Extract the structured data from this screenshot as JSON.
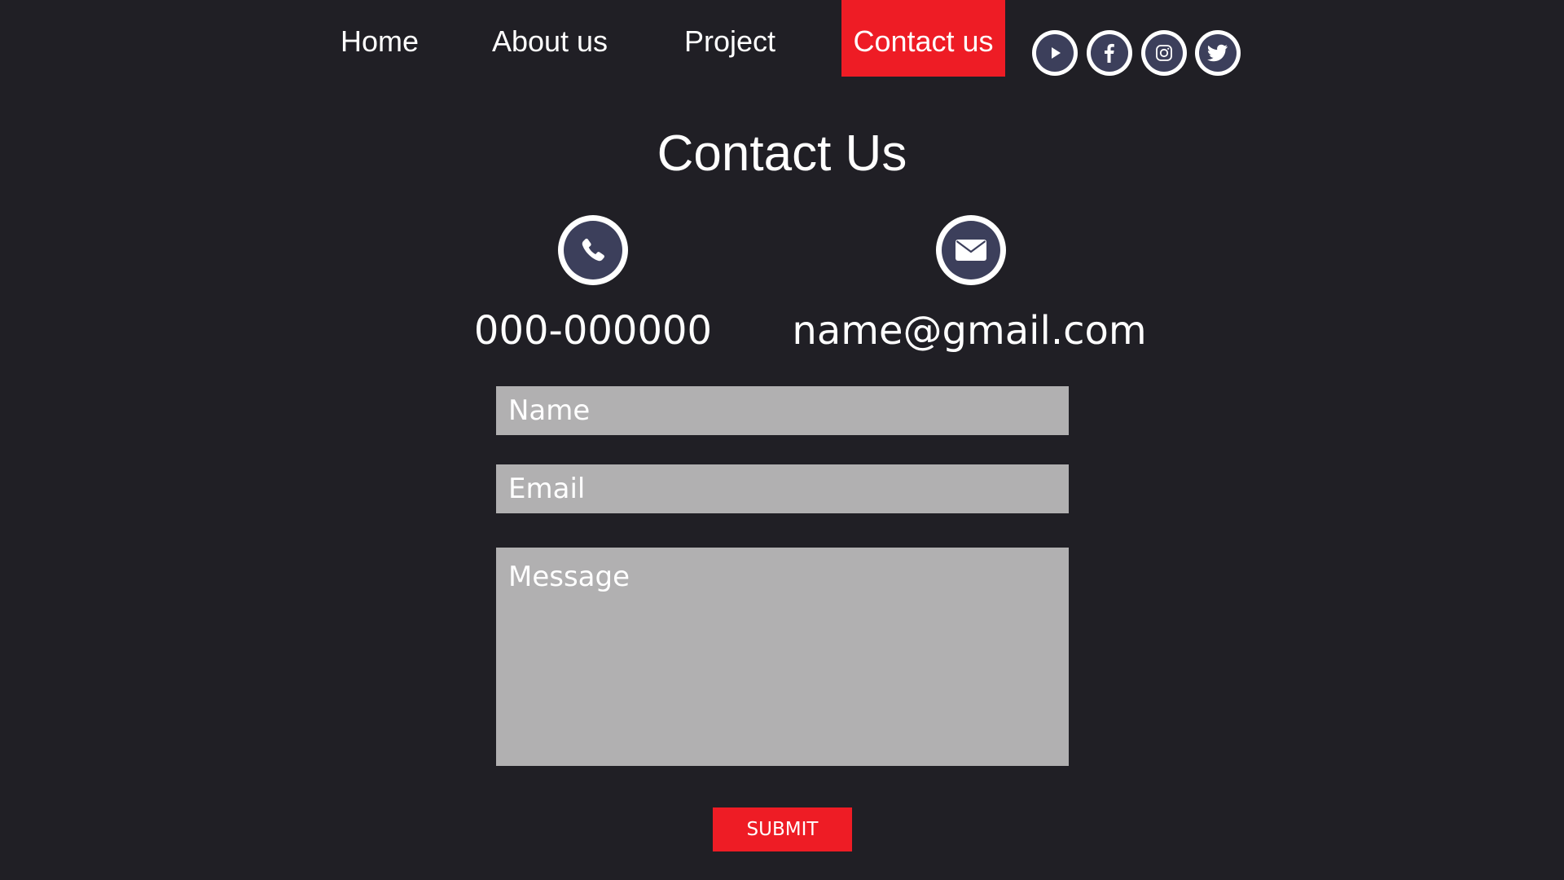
{
  "nav": {
    "items": [
      {
        "label": "Home"
      },
      {
        "label": "About us"
      },
      {
        "label": "Project"
      },
      {
        "label": "Contact us",
        "active": true
      }
    ],
    "active_color": "#ee1c25",
    "social_icons": [
      "youtube-icon",
      "facebook-icon",
      "instagram-icon",
      "twitter-icon"
    ]
  },
  "page": {
    "title": "Contact Us",
    "background": "#201f25"
  },
  "contact": {
    "phone": "000-000000",
    "email": "name@gmail.com",
    "phone_icon": "phone-icon",
    "email_icon": "mail-icon",
    "icon_color": "#3c3f5b"
  },
  "form": {
    "name_placeholder": "Name",
    "email_placeholder": "Email",
    "message_placeholder": "Message",
    "submit_label": "SUBMIT",
    "field_color": "#b1b0b1"
  }
}
